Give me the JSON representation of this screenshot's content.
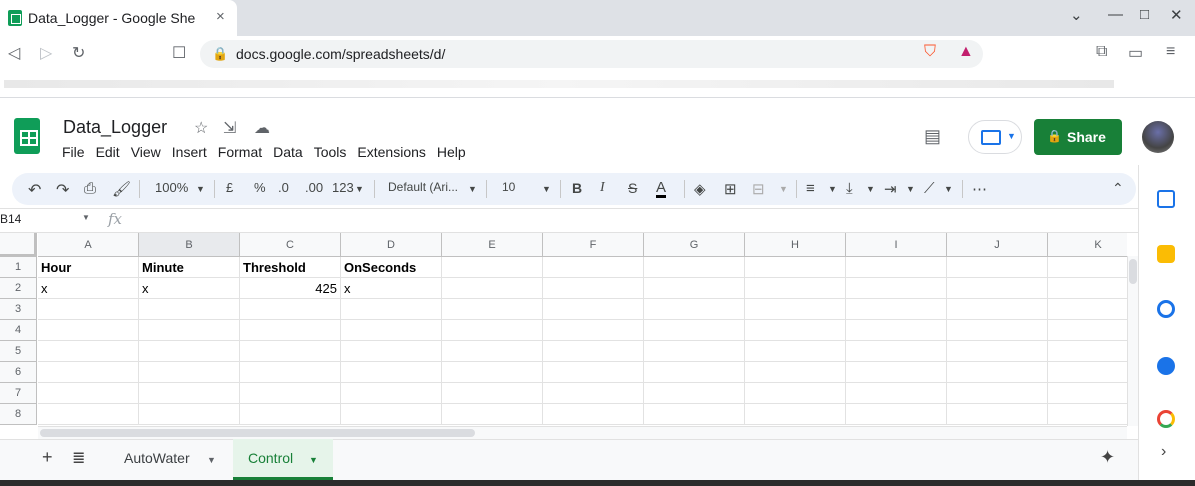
{
  "browser": {
    "tab_title": "Data_Logger - Google She",
    "tab_close": "×",
    "url": "docs.google.com/spreadsheets/d/"
  },
  "sheets": {
    "doc_name": "Data_Logger",
    "menu": [
      "File",
      "Edit",
      "View",
      "Insert",
      "Format",
      "Data",
      "Tools",
      "Extensions",
      "Help"
    ],
    "share_label": "Share",
    "colors": {
      "share": "#188038",
      "accent": "#1a73e8",
      "toolbar": "#edf2fa"
    }
  },
  "toolbar": {
    "zoom": "100%",
    "currency": "£",
    "percent": "%",
    "dec_decrease": ".0",
    "dec_increase": ".00",
    "more_formats": "123",
    "font": "Default (Ari...",
    "font_size": "10",
    "bold": "B",
    "italic": "I",
    "strike": "S",
    "text_color": "A"
  },
  "formula_bar": {
    "name_box": "B14",
    "fx": "fx",
    "value": ""
  },
  "grid": {
    "columns": [
      "A",
      "B",
      "C",
      "D",
      "E",
      "F",
      "G",
      "H",
      "I",
      "J",
      "K"
    ],
    "rows": [
      "1",
      "2",
      "3",
      "4",
      "5",
      "6",
      "7",
      "8"
    ],
    "cells": {
      "A1": "Hour",
      "B1": "Minute",
      "C1": "Threshold",
      "D1": "OnSeconds",
      "A2": "x",
      "B2": "x",
      "C2": "425",
      "D2": "x"
    }
  },
  "sheet_tabs": [
    {
      "label": "AutoWater",
      "active": false
    },
    {
      "label": "Control",
      "active": true
    }
  ]
}
